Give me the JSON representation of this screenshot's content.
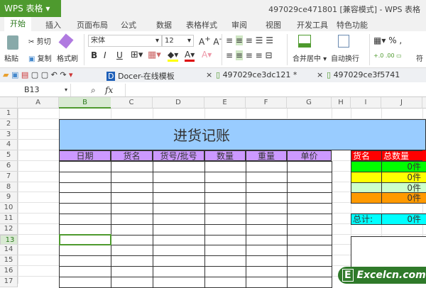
{
  "app": {
    "menu_label": "WPS 表格",
    "window_title": "497029ce471801 [兼容模式] - WPS 表格"
  },
  "tabs": [
    "开始",
    "插入",
    "页面布局",
    "公式",
    "数据",
    "表格样式",
    "审阅",
    "视图",
    "开发工具",
    "特色功能"
  ],
  "ribbon": {
    "paste": "粘贴",
    "cut": "剪切",
    "copy": "复制",
    "format_painter": "格式刷",
    "font": "宋体",
    "font_size": "12",
    "bold": "B",
    "italic": "I",
    "underline": "U",
    "merge_center": "合并居中",
    "wrap_text": "自动换行",
    "percent": "%",
    "symbol": "符"
  },
  "doc_tabs": [
    "Docer-在线模板",
    "497029ce3dc121 *",
    "497029ce3f5741"
  ],
  "formula_bar": {
    "cell_ref": "B13",
    "fx": "fx",
    "value": ""
  },
  "columns": [
    "A",
    "B",
    "C",
    "D",
    "E",
    "F",
    "G",
    "H",
    "I",
    "J"
  ],
  "rows": [
    "1",
    "2",
    "3",
    "4",
    "5",
    "6",
    "7",
    "8",
    "9",
    "10",
    "11",
    "12",
    "13",
    "14",
    "15",
    "16",
    "17"
  ],
  "sheet": {
    "title": "进货记账",
    "headers": [
      "日期",
      "货名",
      "货号/批号",
      "数量",
      "重量",
      "单价"
    ],
    "summary_headers": [
      "货名",
      "总数量"
    ],
    "summary_values": [
      "0件",
      "0件",
      "0件",
      "0件"
    ],
    "summary_colors": [
      "#00ff00",
      "#ffff00",
      "#ccffcc",
      "#ff9900"
    ],
    "total_label": "总计:",
    "total_value": "0件"
  },
  "watermark": "Excelcn.com",
  "colors": {
    "title_fill": "#99ccff",
    "header_fill": "#cc99ff",
    "summary_header": "#ff0000",
    "total_fill": "#00ffff",
    "accent": "#4e9a2e"
  }
}
